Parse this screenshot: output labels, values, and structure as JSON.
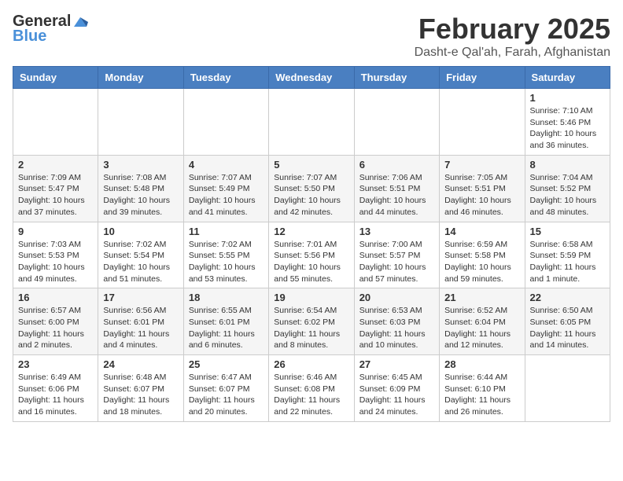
{
  "header": {
    "logo_general": "General",
    "logo_blue": "Blue",
    "month_title": "February 2025",
    "location": "Dasht-e Qal'ah, Farah, Afghanistan"
  },
  "days_of_week": [
    "Sunday",
    "Monday",
    "Tuesday",
    "Wednesday",
    "Thursday",
    "Friday",
    "Saturday"
  ],
  "weeks": [
    [
      {
        "day": "",
        "info": ""
      },
      {
        "day": "",
        "info": ""
      },
      {
        "day": "",
        "info": ""
      },
      {
        "day": "",
        "info": ""
      },
      {
        "day": "",
        "info": ""
      },
      {
        "day": "",
        "info": ""
      },
      {
        "day": "1",
        "info": "Sunrise: 7:10 AM\nSunset: 5:46 PM\nDaylight: 10 hours and 36 minutes."
      }
    ],
    [
      {
        "day": "2",
        "info": "Sunrise: 7:09 AM\nSunset: 5:47 PM\nDaylight: 10 hours and 37 minutes."
      },
      {
        "day": "3",
        "info": "Sunrise: 7:08 AM\nSunset: 5:48 PM\nDaylight: 10 hours and 39 minutes."
      },
      {
        "day": "4",
        "info": "Sunrise: 7:07 AM\nSunset: 5:49 PM\nDaylight: 10 hours and 41 minutes."
      },
      {
        "day": "5",
        "info": "Sunrise: 7:07 AM\nSunset: 5:50 PM\nDaylight: 10 hours and 42 minutes."
      },
      {
        "day": "6",
        "info": "Sunrise: 7:06 AM\nSunset: 5:51 PM\nDaylight: 10 hours and 44 minutes."
      },
      {
        "day": "7",
        "info": "Sunrise: 7:05 AM\nSunset: 5:51 PM\nDaylight: 10 hours and 46 minutes."
      },
      {
        "day": "8",
        "info": "Sunrise: 7:04 AM\nSunset: 5:52 PM\nDaylight: 10 hours and 48 minutes."
      }
    ],
    [
      {
        "day": "9",
        "info": "Sunrise: 7:03 AM\nSunset: 5:53 PM\nDaylight: 10 hours and 49 minutes."
      },
      {
        "day": "10",
        "info": "Sunrise: 7:02 AM\nSunset: 5:54 PM\nDaylight: 10 hours and 51 minutes."
      },
      {
        "day": "11",
        "info": "Sunrise: 7:02 AM\nSunset: 5:55 PM\nDaylight: 10 hours and 53 minutes."
      },
      {
        "day": "12",
        "info": "Sunrise: 7:01 AM\nSunset: 5:56 PM\nDaylight: 10 hours and 55 minutes."
      },
      {
        "day": "13",
        "info": "Sunrise: 7:00 AM\nSunset: 5:57 PM\nDaylight: 10 hours and 57 minutes."
      },
      {
        "day": "14",
        "info": "Sunrise: 6:59 AM\nSunset: 5:58 PM\nDaylight: 10 hours and 59 minutes."
      },
      {
        "day": "15",
        "info": "Sunrise: 6:58 AM\nSunset: 5:59 PM\nDaylight: 11 hours and 1 minute."
      }
    ],
    [
      {
        "day": "16",
        "info": "Sunrise: 6:57 AM\nSunset: 6:00 PM\nDaylight: 11 hours and 2 minutes."
      },
      {
        "day": "17",
        "info": "Sunrise: 6:56 AM\nSunset: 6:01 PM\nDaylight: 11 hours and 4 minutes."
      },
      {
        "day": "18",
        "info": "Sunrise: 6:55 AM\nSunset: 6:01 PM\nDaylight: 11 hours and 6 minutes."
      },
      {
        "day": "19",
        "info": "Sunrise: 6:54 AM\nSunset: 6:02 PM\nDaylight: 11 hours and 8 minutes."
      },
      {
        "day": "20",
        "info": "Sunrise: 6:53 AM\nSunset: 6:03 PM\nDaylight: 11 hours and 10 minutes."
      },
      {
        "day": "21",
        "info": "Sunrise: 6:52 AM\nSunset: 6:04 PM\nDaylight: 11 hours and 12 minutes."
      },
      {
        "day": "22",
        "info": "Sunrise: 6:50 AM\nSunset: 6:05 PM\nDaylight: 11 hours and 14 minutes."
      }
    ],
    [
      {
        "day": "23",
        "info": "Sunrise: 6:49 AM\nSunset: 6:06 PM\nDaylight: 11 hours and 16 minutes."
      },
      {
        "day": "24",
        "info": "Sunrise: 6:48 AM\nSunset: 6:07 PM\nDaylight: 11 hours and 18 minutes."
      },
      {
        "day": "25",
        "info": "Sunrise: 6:47 AM\nSunset: 6:07 PM\nDaylight: 11 hours and 20 minutes."
      },
      {
        "day": "26",
        "info": "Sunrise: 6:46 AM\nSunset: 6:08 PM\nDaylight: 11 hours and 22 minutes."
      },
      {
        "day": "27",
        "info": "Sunrise: 6:45 AM\nSunset: 6:09 PM\nDaylight: 11 hours and 24 minutes."
      },
      {
        "day": "28",
        "info": "Sunrise: 6:44 AM\nSunset: 6:10 PM\nDaylight: 11 hours and 26 minutes."
      },
      {
        "day": "",
        "info": ""
      }
    ]
  ]
}
